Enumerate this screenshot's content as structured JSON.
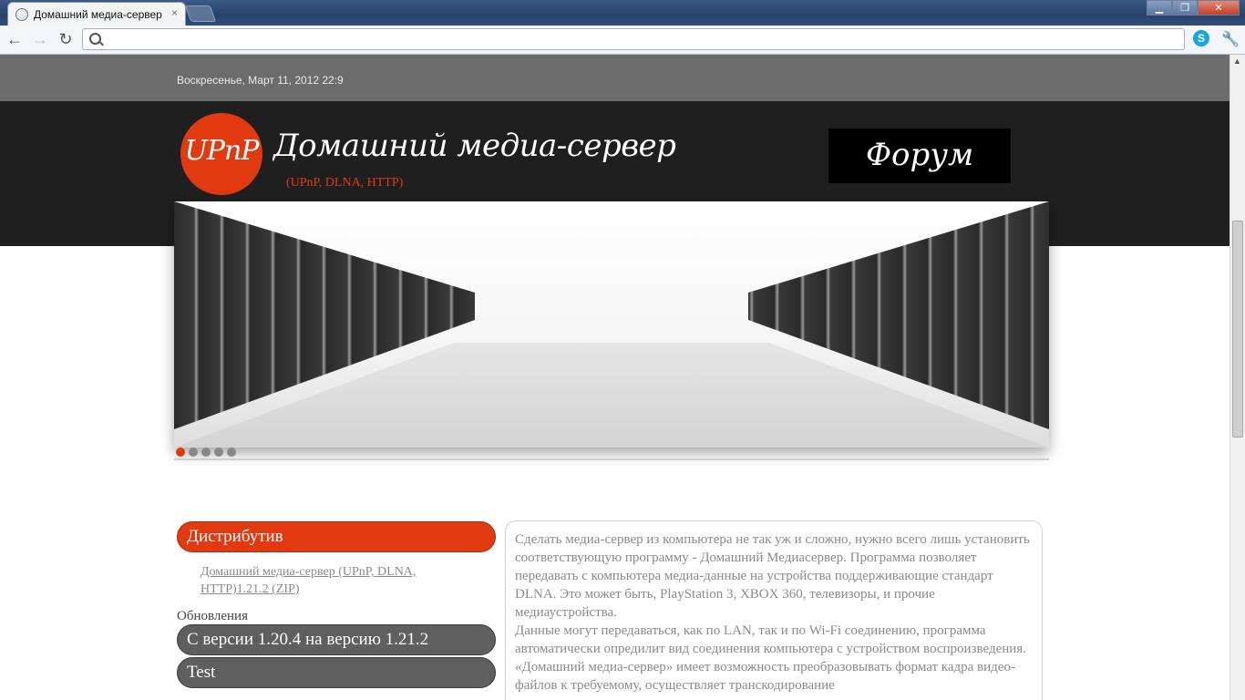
{
  "browser": {
    "tab_title": "Домашний медиа-сервер",
    "tab_close": "×",
    "url": ""
  },
  "page": {
    "date": "Воскресенье, Март 11, 2012 22:9",
    "logo_text": "UPnP",
    "site_title": "Домашний медиа-сервер",
    "site_subtitle": "(UPnP, DLNA, HTTP)",
    "forum_label": "Форум",
    "slider": {
      "count": 5,
      "active": 1
    },
    "sidebar": {
      "distributive_label": "Дистрибутив",
      "distributive_link": "Домашний медиа-сервер (UPnP, DLNA, HTTP)1.21.2 (ZIP)",
      "updates_heading": "Обновления",
      "update_1": "С версии 1.20.4 на версию 1.21.2",
      "update_2": "Test"
    },
    "content": {
      "paragraph_1": "Сделать медиа-сервер из компьютера не так уж и сложно, нужно всего лишь установить соответствующую программу - Домашний Медиасервер. Программа позволяет передавать с компьютера медиа-данные на устройства поддерживающие стандарт DLNA. Это может быть, PlayStation 3, XBOX 360, телевизоры, и прочие медиаустройства.",
      "paragraph_2": "Данные могут передаваться, как по LAN, так и по Wi-Fi соединению, программа автоматически опредилит вид соединения компьютера с устройством воспроизведения. «Домашний медиа-сервер» имеет возможность преобразовывать формат кадра видео-файлов к требуемому, осуществляет транскодирование"
    }
  },
  "colors": {
    "accent": "#e23a10",
    "header_bg": "#1f1f1f",
    "datebar_bg": "#6c6c6c"
  },
  "icons": [
    "globe-icon",
    "back-icon",
    "forward-icon",
    "reload-icon",
    "search-icon",
    "skype-icon",
    "wrench-icon"
  ]
}
